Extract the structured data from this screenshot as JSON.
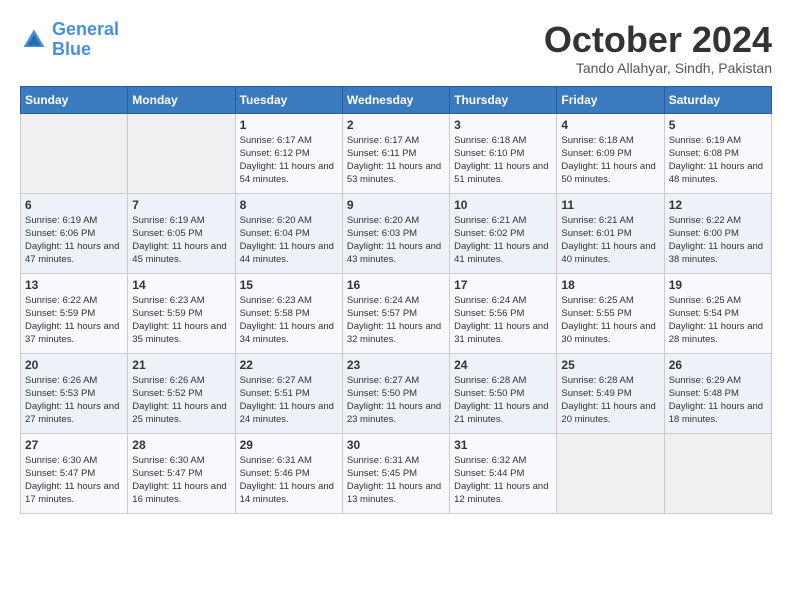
{
  "header": {
    "logo_line1": "General",
    "logo_line2": "Blue",
    "month": "October 2024",
    "location": "Tando Allahyar, Sindh, Pakistan"
  },
  "weekdays": [
    "Sunday",
    "Monday",
    "Tuesday",
    "Wednesday",
    "Thursday",
    "Friday",
    "Saturday"
  ],
  "weeks": [
    [
      {
        "day": "",
        "text": ""
      },
      {
        "day": "",
        "text": ""
      },
      {
        "day": "1",
        "text": "Sunrise: 6:17 AM\nSunset: 6:12 PM\nDaylight: 11 hours and 54 minutes."
      },
      {
        "day": "2",
        "text": "Sunrise: 6:17 AM\nSunset: 6:11 PM\nDaylight: 11 hours and 53 minutes."
      },
      {
        "day": "3",
        "text": "Sunrise: 6:18 AM\nSunset: 6:10 PM\nDaylight: 11 hours and 51 minutes."
      },
      {
        "day": "4",
        "text": "Sunrise: 6:18 AM\nSunset: 6:09 PM\nDaylight: 11 hours and 50 minutes."
      },
      {
        "day": "5",
        "text": "Sunrise: 6:19 AM\nSunset: 6:08 PM\nDaylight: 11 hours and 48 minutes."
      }
    ],
    [
      {
        "day": "6",
        "text": "Sunrise: 6:19 AM\nSunset: 6:06 PM\nDaylight: 11 hours and 47 minutes."
      },
      {
        "day": "7",
        "text": "Sunrise: 6:19 AM\nSunset: 6:05 PM\nDaylight: 11 hours and 45 minutes."
      },
      {
        "day": "8",
        "text": "Sunrise: 6:20 AM\nSunset: 6:04 PM\nDaylight: 11 hours and 44 minutes."
      },
      {
        "day": "9",
        "text": "Sunrise: 6:20 AM\nSunset: 6:03 PM\nDaylight: 11 hours and 43 minutes."
      },
      {
        "day": "10",
        "text": "Sunrise: 6:21 AM\nSunset: 6:02 PM\nDaylight: 11 hours and 41 minutes."
      },
      {
        "day": "11",
        "text": "Sunrise: 6:21 AM\nSunset: 6:01 PM\nDaylight: 11 hours and 40 minutes."
      },
      {
        "day": "12",
        "text": "Sunrise: 6:22 AM\nSunset: 6:00 PM\nDaylight: 11 hours and 38 minutes."
      }
    ],
    [
      {
        "day": "13",
        "text": "Sunrise: 6:22 AM\nSunset: 5:59 PM\nDaylight: 11 hours and 37 minutes."
      },
      {
        "day": "14",
        "text": "Sunrise: 6:23 AM\nSunset: 5:59 PM\nDaylight: 11 hours and 35 minutes."
      },
      {
        "day": "15",
        "text": "Sunrise: 6:23 AM\nSunset: 5:58 PM\nDaylight: 11 hours and 34 minutes."
      },
      {
        "day": "16",
        "text": "Sunrise: 6:24 AM\nSunset: 5:57 PM\nDaylight: 11 hours and 32 minutes."
      },
      {
        "day": "17",
        "text": "Sunrise: 6:24 AM\nSunset: 5:56 PM\nDaylight: 11 hours and 31 minutes."
      },
      {
        "day": "18",
        "text": "Sunrise: 6:25 AM\nSunset: 5:55 PM\nDaylight: 11 hours and 30 minutes."
      },
      {
        "day": "19",
        "text": "Sunrise: 6:25 AM\nSunset: 5:54 PM\nDaylight: 11 hours and 28 minutes."
      }
    ],
    [
      {
        "day": "20",
        "text": "Sunrise: 6:26 AM\nSunset: 5:53 PM\nDaylight: 11 hours and 27 minutes."
      },
      {
        "day": "21",
        "text": "Sunrise: 6:26 AM\nSunset: 5:52 PM\nDaylight: 11 hours and 25 minutes."
      },
      {
        "day": "22",
        "text": "Sunrise: 6:27 AM\nSunset: 5:51 PM\nDaylight: 11 hours and 24 minutes."
      },
      {
        "day": "23",
        "text": "Sunrise: 6:27 AM\nSunset: 5:50 PM\nDaylight: 11 hours and 23 minutes."
      },
      {
        "day": "24",
        "text": "Sunrise: 6:28 AM\nSunset: 5:50 PM\nDaylight: 11 hours and 21 minutes."
      },
      {
        "day": "25",
        "text": "Sunrise: 6:28 AM\nSunset: 5:49 PM\nDaylight: 11 hours and 20 minutes."
      },
      {
        "day": "26",
        "text": "Sunrise: 6:29 AM\nSunset: 5:48 PM\nDaylight: 11 hours and 18 minutes."
      }
    ],
    [
      {
        "day": "27",
        "text": "Sunrise: 6:30 AM\nSunset: 5:47 PM\nDaylight: 11 hours and 17 minutes."
      },
      {
        "day": "28",
        "text": "Sunrise: 6:30 AM\nSunset: 5:47 PM\nDaylight: 11 hours and 16 minutes."
      },
      {
        "day": "29",
        "text": "Sunrise: 6:31 AM\nSunset: 5:46 PM\nDaylight: 11 hours and 14 minutes."
      },
      {
        "day": "30",
        "text": "Sunrise: 6:31 AM\nSunset: 5:45 PM\nDaylight: 11 hours and 13 minutes."
      },
      {
        "day": "31",
        "text": "Sunrise: 6:32 AM\nSunset: 5:44 PM\nDaylight: 11 hours and 12 minutes."
      },
      {
        "day": "",
        "text": ""
      },
      {
        "day": "",
        "text": ""
      }
    ]
  ]
}
